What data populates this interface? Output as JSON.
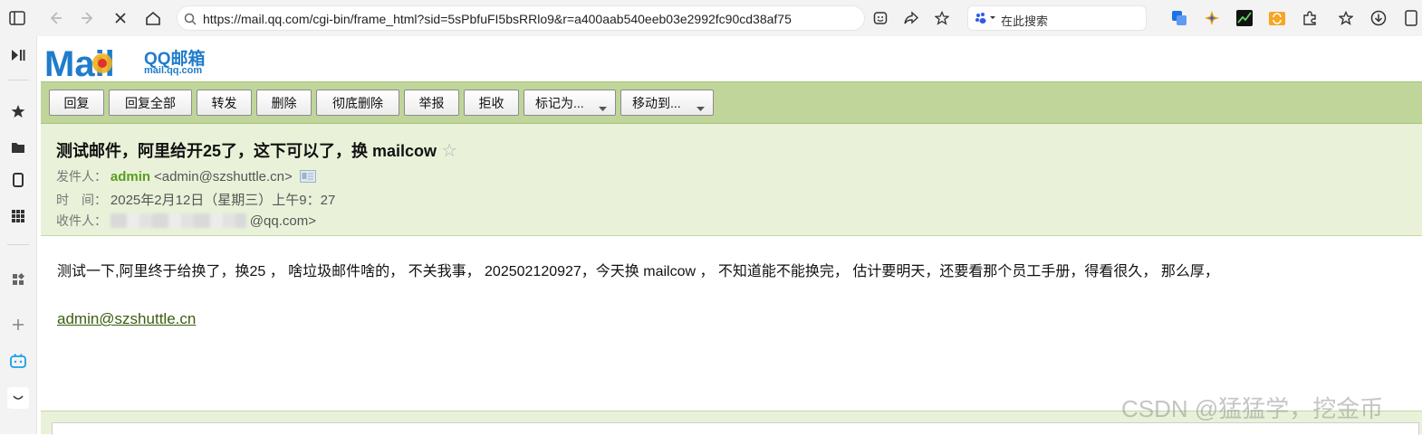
{
  "browser": {
    "url": "https://mail.qq.com/cgi-bin/frame_html?sid=5sPbfuFI5bsRRlo9&r=a400aab540eeb03e2992fc90cd38af75",
    "search_placeholder": "在此搜索"
  },
  "logo": {
    "mark": "Mail",
    "cn_name": "QQ邮箱",
    "domain": "mail.qq.com"
  },
  "toolbar": {
    "buttons": [
      "回复",
      "回复全部",
      "转发",
      "删除",
      "彻底删除",
      "举报",
      "拒收"
    ],
    "mark_as": "标记为...",
    "move_to": "移动到..."
  },
  "email": {
    "subject": "测试邮件，阿里给开25了，这下可以了，换 mailcow",
    "from_label": "发件人：",
    "from_name": "admin",
    "from_addr": "<admin@szshuttle.cn>",
    "time_label": "时　间：",
    "time_value": "2025年2月12日（星期三）上午9：27",
    "to_label": "收件人：",
    "to_suffix": "@qq.com>",
    "body": "测试一下,阿里终于给换了，换25 ，  啥垃圾邮件啥的，  不关我事，  202502120927，今天换 mailcow ，  不知道能不能换完，  估计要明天，还要看那个员工手册，得看很久，  那么厚，",
    "signature": "admin@szshuttle.cn"
  },
  "watermark": "CSDN @猛猛学，挖金币",
  "colors": {
    "toolbar_bg": "#c0d59a",
    "header_bg": "#e9f2d9",
    "sender_green": "#5a9d1f"
  }
}
